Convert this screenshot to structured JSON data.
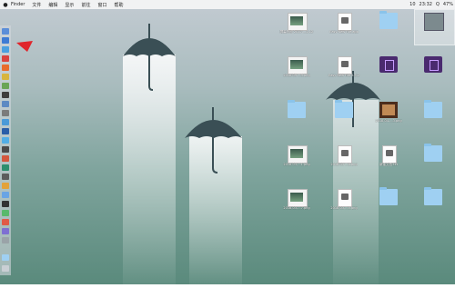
{
  "menubar": {
    "apple": "",
    "items": [
      "Finder",
      "文件",
      "编辑",
      "显示",
      "前往",
      "窗口",
      "帮助"
    ],
    "status": [
      "10",
      "23:32",
      "Q"
    ],
    "battery": "47%"
  },
  "desktop": {
    "items": [
      {
        "label": "屏幕快照 2017-...2.12",
        "type": "shot"
      },
      {
        "label": "Easy New File.app",
        "type": "doc"
      },
      {
        "label": "",
        "type": "folder"
      },
      {
        "label": "",
        "type": "folder"
      },
      {
        "label": "2018-09-...9.png",
        "type": "shot"
      },
      {
        "label": "Easy New File 2.3.2",
        "type": "doc"
      },
      {
        "label": "",
        "type": "purple"
      },
      {
        "label": "",
        "type": "purple"
      },
      {
        "label": "",
        "type": "folder"
      },
      {
        "label": "",
        "type": "folder"
      },
      {
        "label": "2018-04-...3.png",
        "type": "book"
      },
      {
        "label": "",
        "type": "folder"
      },
      {
        "label": "2018-03-...1.png",
        "type": "shot"
      },
      {
        "label": "2018-03-...8.png",
        "type": "doc"
      },
      {
        "label": "新建文档.txt",
        "type": "doc"
      },
      {
        "label": "",
        "type": "folder"
      },
      {
        "label": "2018-03-...7.png",
        "type": "shot"
      },
      {
        "label": "2018-03-...5.png",
        "type": "doc"
      },
      {
        "label": "",
        "type": "folder"
      },
      {
        "label": "",
        "type": "folder"
      }
    ]
  },
  "colors": {
    "accent": "#e0252b",
    "umbrella": "#3a4f55"
  }
}
